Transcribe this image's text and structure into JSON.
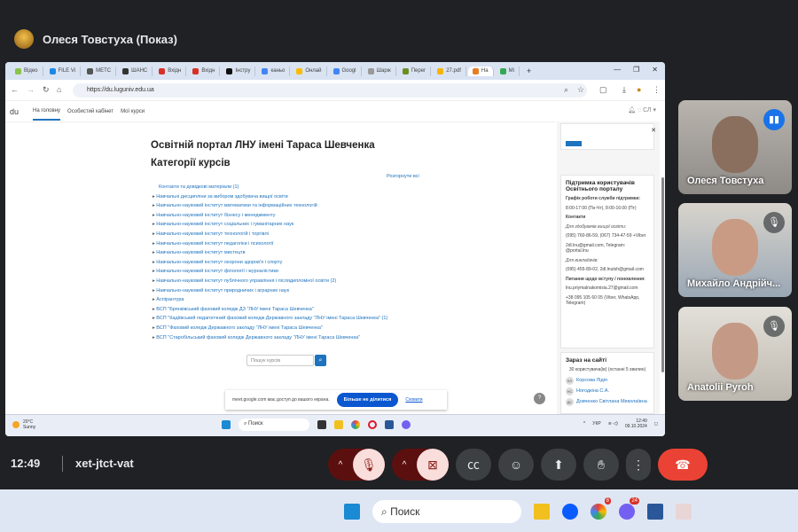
{
  "meet": {
    "presenter_title": "Олеся Товстуха (Показ)",
    "time": "12:49",
    "meeting_code": "xet-jtct-vat"
  },
  "browser": {
    "tabs": [
      "Відео",
      "FILE Vi",
      "МЕТС",
      "ШАНС",
      "Вхідн",
      "Вхідн",
      "Інстру",
      "каньо",
      "Онлай",
      "Googl",
      "Шарж",
      "Перег",
      "27.pdf",
      "На",
      "Мі"
    ],
    "active_tab": 13,
    "url": "https://du.luguniv.edu.ua"
  },
  "site": {
    "logo": "du",
    "nav": [
      "На головну",
      "Особистий кабінет",
      "Мої курси"
    ],
    "user_initials": "СЛ",
    "title": "Освітній портал ЛНУ імені Тараса Шевченка",
    "subtitle": "Категорії курсів",
    "expand_all": "Розгорнути всі",
    "categories": [
      "Контакти та довідкові матеріали (1)",
      "Навчальні дисципліни за вибором здобувача вищої освіти",
      "Навчально-науковий інститут математики та інформаційних технологій",
      "Навчально-науковий інститут бізнесу і менеджменту",
      "Навчально-науковий інститут соціальних і гуманітарних наук",
      "Навчально-науковий інститут технологій і торгівлі",
      "Навчально-науковий інститут педагогіки і психології",
      "Навчально-науковий інститут мистецтв",
      "Навчально-науковий інститут охорони здоров'я і спорту",
      "Навчально-науковий інститут філології і журналістики",
      "Навчально-науковий інститут публічного управління і післядипломної освіти (2)",
      "Навчально-науковий інститут природничих і аграрних наук",
      "Аспірантура",
      "ВСП \"Брянківський фаховий коледж ДЗ \"ЛНУ імені Тараса Шевченка\"",
      "ВСП \"Кадіївський педагогічний фаховий коледж Державного закладу \"ЛНУ імені Тараса Шевченка\" (1)",
      "ВСП \"Фаховий коледж Державного закладу \"ЛНУ імені Тараса Шевченка\"",
      "ВСП \"Старобільський фаховий коледж Державного закладу \"ЛНУ імені Тараса Шевченка\""
    ],
    "search_placeholder": "Пошук курсів",
    "support": {
      "title": "Підтримка користувачів Освітнього порталу",
      "schedule_label": "Графік роботи служби підтримки:",
      "schedule": "8:00-17:00 (Пн-Чт), 8:00-16:00 (Пт)",
      "contacts_label": "Контакти",
      "students_label": "Для здобувачів вищої освіти:",
      "students_phones": "(095) 760-86-59, (067) 734-47-59 +Viber",
      "students_email": "2dl.lnu@gmail.com, Telegram: @portal.lnu",
      "teachers_label": "Для викладачів:",
      "teachers_contact": "(095) 455-89-02, 2dl.lnutsh@gmail.com",
      "admission_label": "Питання щодо вступу / поновлення:",
      "admission_email": "lnu.priymalnakomisia.27@gmail.com",
      "admission_phone": "+38 095 105 60 05 (Viber, WhatsApp, Telegram)"
    },
    "online": {
      "title": "Зараз на сайті",
      "count": "30 користувача(ів) (останні 5 хвилин)",
      "users": [
        {
          "initials": "КЛ",
          "name": "Корсова Лідія"
        },
        {
          "initials": "НС",
          "name": "Ногодкіна С.А."
        },
        {
          "initials": "ДС",
          "name": "Довченко Світлана Миколаївна"
        }
      ]
    },
    "help": "?"
  },
  "sharebar": {
    "message": "meet.google.com має доступ до вашого екрана.",
    "stop": "Більше не ділитися",
    "hide": "Сховати"
  },
  "shared_taskbar": {
    "temp": "20°C",
    "weather": "Sunny",
    "search": "Поиск",
    "lang": "УКР",
    "time": "12:49",
    "date": "09.10.2024"
  },
  "participants": [
    {
      "name": "Олеся Товстуха",
      "speaking": true
    },
    {
      "name": "Михайло Андрійч...",
      "muted": true
    },
    {
      "name": "Anatolii Pyroh",
      "muted": true
    }
  ],
  "host_taskbar": {
    "search": "Поиск",
    "chrome_badge": "8",
    "viber_badge": "24"
  },
  "colors": {
    "hangup": "#ea4335",
    "accent": "#1a73e8",
    "link": "#1e73be"
  }
}
